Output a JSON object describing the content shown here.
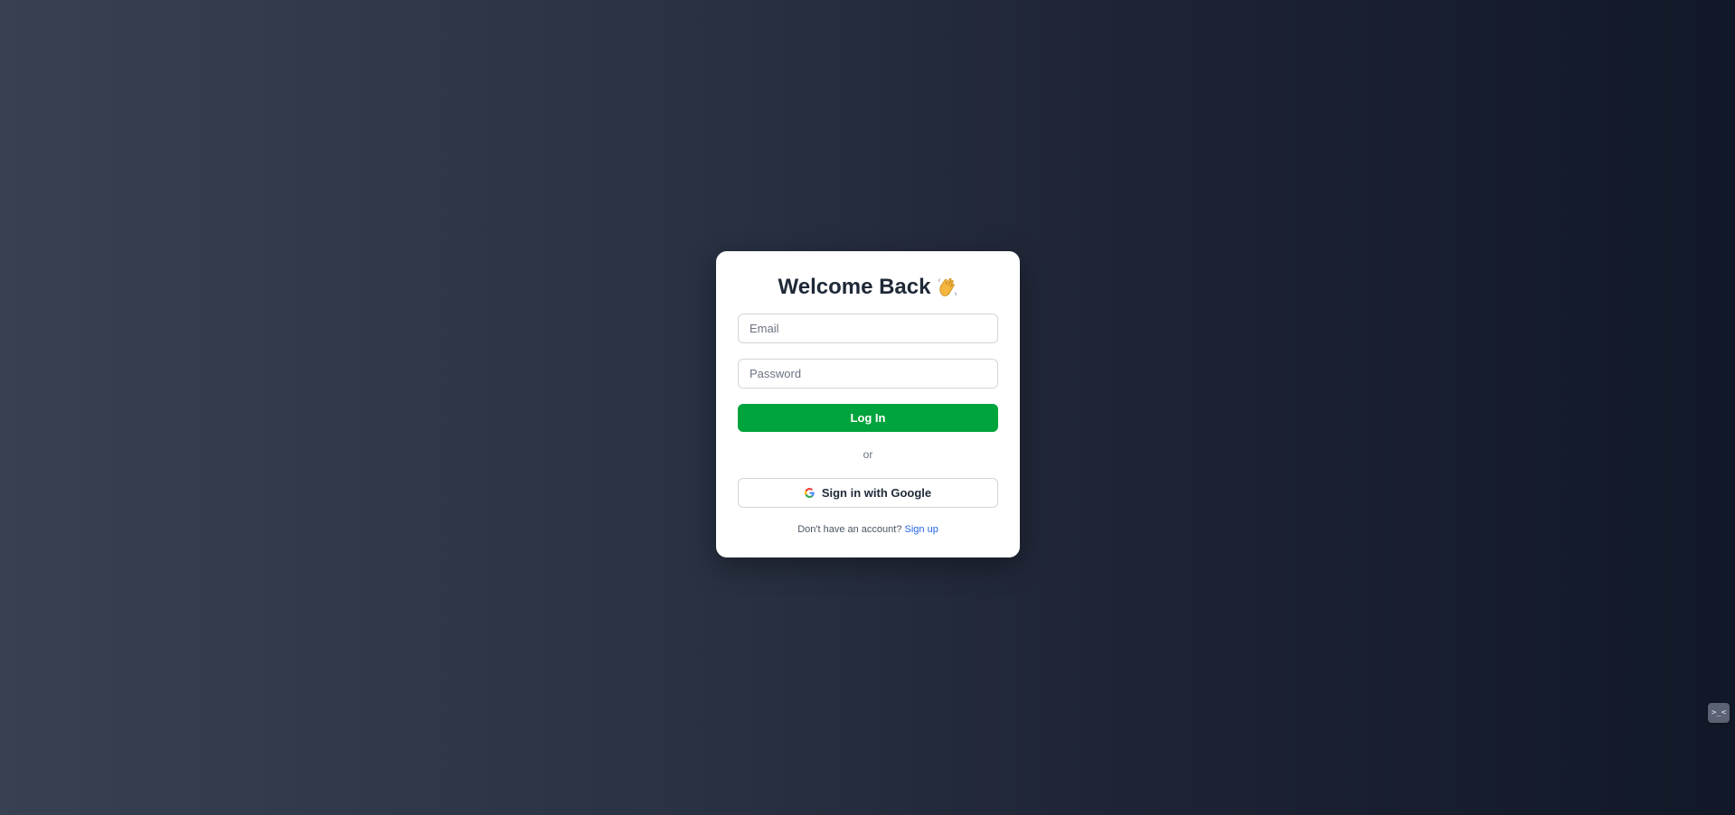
{
  "login": {
    "title": "Welcome Back",
    "title_emoji": "waving-hand-icon",
    "email_placeholder": "Email",
    "password_placeholder": "Password",
    "login_label": "Log In",
    "divider": "or",
    "google_label": "Sign in with Google",
    "google_icon": "google-icon",
    "signup_prompt": "Don't have an account?",
    "signup_link": "Sign up"
  },
  "colors": {
    "login_button": "#00a43c",
    "link": "#2563eb",
    "heading": "#1f2937"
  },
  "corner_widget": {
    "label": ">_<",
    "icon": "terminal-icon"
  }
}
